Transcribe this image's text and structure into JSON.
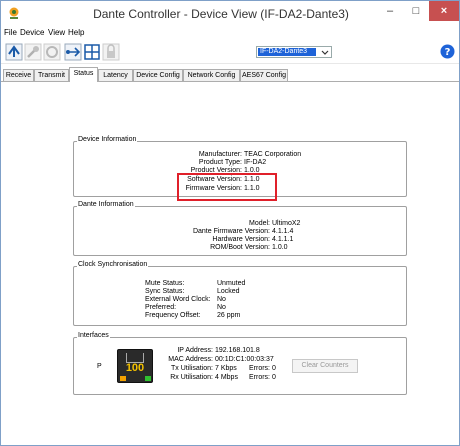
{
  "window": {
    "title": "Dante Controller - Device View (IF-DA2-Dante3)",
    "minimize_symbol": "–",
    "maximize_symbol": "□",
    "close_symbol": "×"
  },
  "menu": [
    "File",
    "Device",
    "View",
    "Help"
  ],
  "toolbar": {
    "device_selected": "IF-DA2-Dante3",
    "icons": [
      "refresh-icon",
      "wrench-icon",
      "reboot-icon",
      "network-icon",
      "grid-icon",
      "lock-icon",
      "help-icon"
    ]
  },
  "tabs": [
    "Receive",
    "Transmit",
    "Status",
    "Latency",
    "Device Config",
    "Network Config",
    "AES67 Config"
  ],
  "active_tab": "Status",
  "device_information": {
    "title": "Device Information",
    "manufacturer_label": "Manufacturer:",
    "manufacturer": "TEAC Corporation",
    "product_type_label": "Product Type:",
    "product_type": "IF-DA2",
    "product_version_label": "Product Version:",
    "product_version": "1.0.0",
    "software_version_label": "Software Version:",
    "software_version": "1.1.0",
    "firmware_version_label": "Firmware Version:",
    "firmware_version": "1.1.0"
  },
  "dante_information": {
    "title": "Dante Information",
    "model_label": "Model:",
    "model": "UltimoX2",
    "dante_firmware_label": "Dante Firmware Version:",
    "dante_firmware": "4.1.1.4",
    "hardware_label": "Hardware Version:",
    "hardware": "4.1.1.1",
    "rom_boot_label": "ROM/Boot Version:",
    "rom_boot": "1.0.0"
  },
  "clock_sync": {
    "title": "Clock Synchronisation",
    "mute_status_label": "Mute Status:",
    "mute_status": "Unmuted",
    "sync_status_label": "Sync Status:",
    "sync_status": "Locked",
    "external_word_clock_label": "External Word Clock:",
    "external_word_clock": "No",
    "preferred_label": "Preferred:",
    "preferred": "No",
    "frequency_offset_label": "Frequency Offset:",
    "frequency_offset": "26 ppm"
  },
  "interfaces": {
    "title": "Interfaces",
    "port_label": "P",
    "link_speed": "100",
    "ip_address_label": "IP Address:",
    "ip_address": "192.168.101.8",
    "mac_address_label": "MAC Address:",
    "mac_address": "00:1D:C1:00:03:37",
    "tx_label": "Tx Utilisation:",
    "tx": "7 Kbps",
    "tx_errors_label": "Errors:",
    "tx_errors": "0",
    "rx_label": "Rx Utilisation:",
    "rx": "4 Mbps",
    "rx_errors_label": "Errors:",
    "rx_errors": "0",
    "clear_counters": "Clear Counters"
  },
  "colors": {
    "highlight": "#e0202a",
    "selection": "#1e63d8",
    "close_button": "#c75050"
  }
}
